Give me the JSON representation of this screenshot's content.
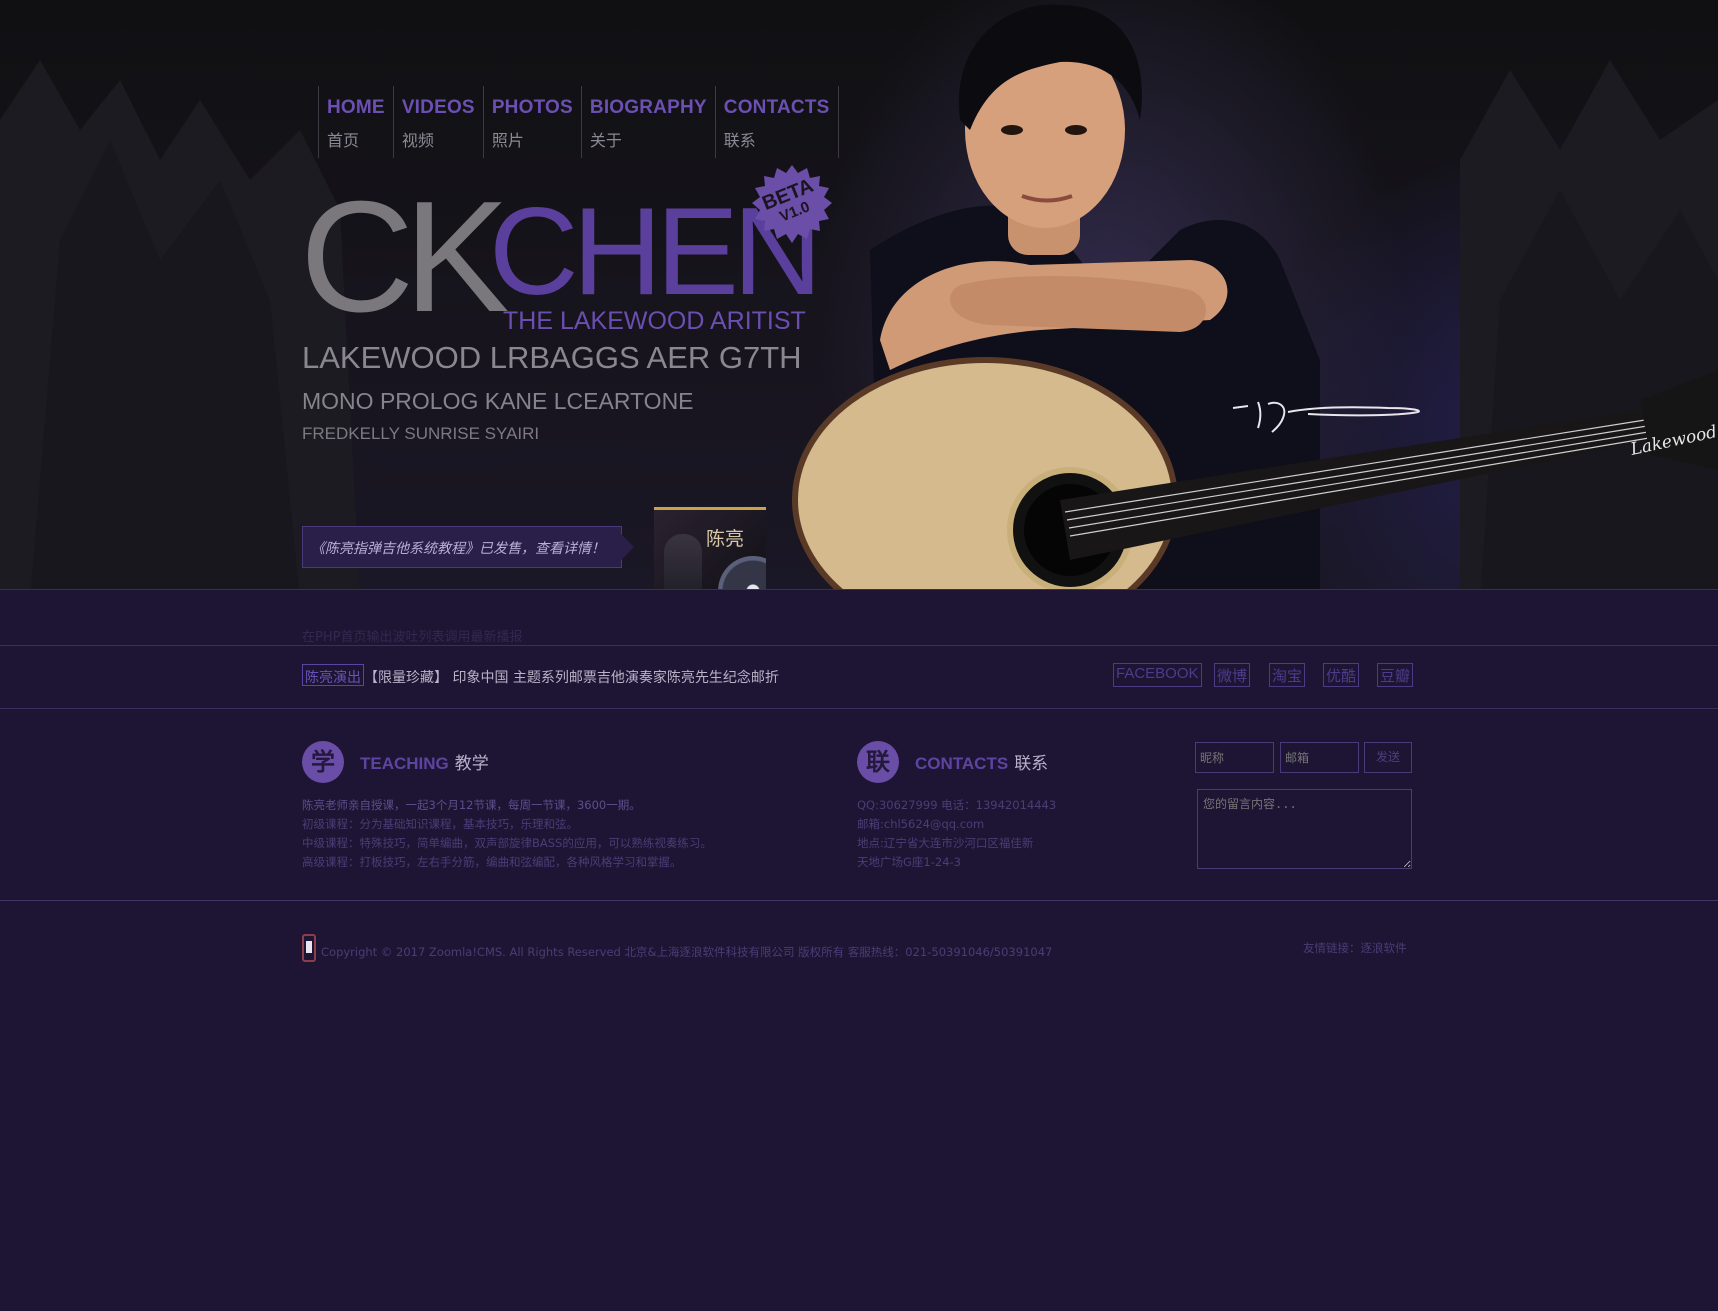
{
  "nav": [
    {
      "en": "HOME",
      "cn": "首页"
    },
    {
      "en": "VIDEOS",
      "cn": "视频"
    },
    {
      "en": "PHOTOS",
      "cn": "照片"
    },
    {
      "en": "BIOGRAPHY",
      "cn": "关于"
    },
    {
      "en": "CONTACTS",
      "cn": "联系"
    }
  ],
  "logo": {
    "ck": "CK",
    "chen": "CHEN",
    "subtitle": "THE LAKEWOOD ARITIST",
    "badge_top": "BETA",
    "badge_bottom": "V1.0"
  },
  "hero": {
    "line1": "LAKEWOOD LRBAGGS AER G7TH",
    "line2": "MONO PROLOG KANE LCEARTONE",
    "line3": "FREDKELLY SUNRISE SYAIRI",
    "promo": "《陈亮指弹吉他系统教程》已发售，查看详情！",
    "album_name": "陈亮"
  },
  "notice": "在PHP首页输出波吐列表调用最新播报",
  "news": {
    "tag": "陈亮演出",
    "text": "【限量珍藏】 印象中国 主题系列邮票吉他演奏家陈亮先生纪念邮折"
  },
  "social": [
    "FACEBOOK",
    "微博",
    "淘宝",
    "优酷",
    "豆瓣"
  ],
  "teaching": {
    "icon": "学",
    "title_en": "TEACHING",
    "title_cn": "教学",
    "lines": [
      "陈亮老师亲自授课，一起3个月12节课，每周一节课，3600一期。",
      "初级课程：分为基础知识课程，基本技巧，乐理和弦。",
      "中级课程：特殊技巧，简单编曲，双声部旋律BASS的应用，可以熟练视奏练习。",
      "高级课程：打板技巧，左右手分筋，编曲和弦编配，各种风格学习和掌握。"
    ]
  },
  "contacts": {
    "icon": "联",
    "title_en": "CONTACTS",
    "title_cn": "联系",
    "lines": [
      "QQ:30627999 电话：13942014443",
      "邮箱:chl5624@qq.com",
      "地点:辽宁省大连市沙河口区福佳新",
      "天地广场G座1-24-3"
    ]
  },
  "form": {
    "nickname_placeholder": "昵称",
    "email_placeholder": "邮箱",
    "send_label": "发送",
    "message_placeholder": "您的留言内容..."
  },
  "footer": {
    "copyright": "Copyright © 2017 Zoomla!CMS. All Rights Reserved 北京&上海逐浪软件科技有限公司 版权所有 客服热线：021-50391046/50391047",
    "friend_links": "友情链接：逐浪软件"
  },
  "colors": {
    "background": "#1e1535",
    "accent": "#6a4da6",
    "nav_text": "#6c4fb2"
  }
}
